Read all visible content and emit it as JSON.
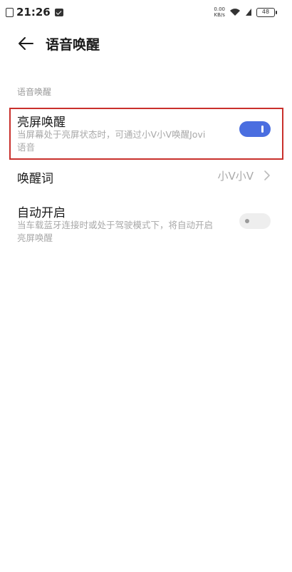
{
  "status_bar": {
    "time": "21:26",
    "speed_value": "0.00",
    "speed_unit": "KB/s",
    "battery": "48"
  },
  "header": {
    "title": "语音唤醒"
  },
  "section": {
    "label": "语音唤醒"
  },
  "settings": [
    {
      "title": "亮屏唤醒",
      "desc_line1": "当屏幕处于亮屏状态时，可通过小V小V唤醒Jovi",
      "desc_line2": "语音",
      "toggle": true
    },
    {
      "title": "唤醒词",
      "value": "小V小V"
    },
    {
      "title": "自动开启",
      "desc_line1": "当车载蓝牙连接时或处于驾驶模式下，将自动开启",
      "desc_line2": "亮屏唤醒",
      "toggle": false
    }
  ],
  "colors": {
    "accent": "#4a6ee0",
    "highlight_border": "#c9302c"
  }
}
